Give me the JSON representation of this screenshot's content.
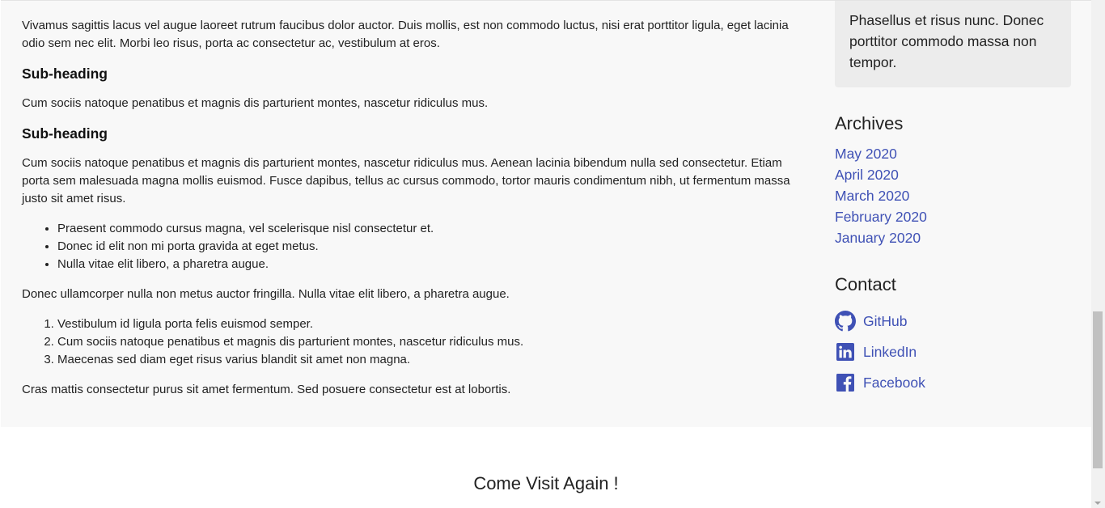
{
  "main": {
    "para1": "Vivamus sagittis lacus vel augue laoreet rutrum faucibus dolor auctor. Duis mollis, est non commodo luctus, nisi erat porttitor ligula, eget lacinia odio sem nec elit. Morbi leo risus, porta ac consectetur ac, vestibulum at eros.",
    "subheading1": "Sub-heading",
    "para2": "Cum sociis natoque penatibus et magnis dis parturient montes, nascetur ridiculus mus.",
    "subheading2": "Sub-heading",
    "para3": "Cum sociis natoque penatibus et magnis dis parturient montes, nascetur ridiculus mus. Aenean lacinia bibendum nulla sed consectetur. Etiam porta sem malesuada magna mollis euismod. Fusce dapibus, tellus ac cursus commodo, tortor mauris condimentum nibh, ut fermentum massa justo sit amet risus.",
    "bullets": [
      "Praesent commodo cursus magna, vel scelerisque nisl consectetur et.",
      "Donec id elit non mi porta gravida at eget metus.",
      "Nulla vitae elit libero, a pharetra augue."
    ],
    "para4": "Donec ullamcorper nulla non metus auctor fringilla. Nulla vitae elit libero, a pharetra augue.",
    "numbered": [
      "Vestibulum id ligula porta felis euismod semper.",
      "Cum sociis natoque penatibus et magnis dis parturient montes, nascetur ridiculus mus.",
      "Maecenas sed diam eget risus varius blandit sit amet non magna."
    ],
    "para5": "Cras mattis consectetur purus sit amet fermentum. Sed posuere consectetur est at lobortis."
  },
  "sidebar": {
    "about_text": "Phasellus et risus nunc. Donec porttitor commodo massa non tempor.",
    "archives_title": "Archives",
    "archives": [
      "May 2020",
      "April 2020",
      "March 2020",
      "February 2020",
      "January 2020"
    ],
    "contact_title": "Contact",
    "contacts": [
      {
        "label": "GitHub",
        "icon": "github-icon"
      },
      {
        "label": "LinkedIn",
        "icon": "linkedin-icon"
      },
      {
        "label": "Facebook",
        "icon": "facebook-icon"
      }
    ]
  },
  "footer": {
    "text": "Come Visit Again !"
  },
  "colors": {
    "link": "#3f51b5",
    "band_bg": "#f8f8f8",
    "sidebar_box_bg": "#ececec"
  }
}
